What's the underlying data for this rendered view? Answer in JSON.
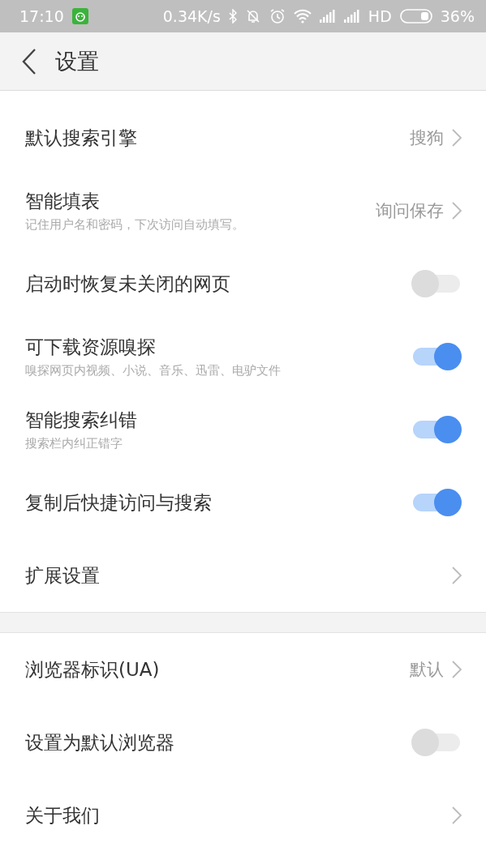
{
  "status_bar": {
    "time": "17:10",
    "speed": "0.34K/s",
    "network": "HD",
    "battery": "36%"
  },
  "header": {
    "title": "设置"
  },
  "sections": [
    {
      "items": [
        {
          "kind": "link",
          "label": "默认搜索引擎",
          "value": "搜狗"
        },
        {
          "kind": "link",
          "label": "智能填表",
          "subtitle": "记住用户名和密码，下次访问自动填写。",
          "value": "询问保存"
        },
        {
          "kind": "toggle",
          "label": "启动时恢复未关闭的网页",
          "on": false
        },
        {
          "kind": "toggle",
          "label": "可下载资源嗅探",
          "subtitle": "嗅探网页内视频、小说、音乐、迅雷、电驴文件",
          "on": true
        },
        {
          "kind": "toggle",
          "label": "智能搜索纠错",
          "subtitle": "搜索栏内纠正错字",
          "on": true
        },
        {
          "kind": "toggle",
          "label": "复制后快捷访问与搜索",
          "on": true
        },
        {
          "kind": "link",
          "label": "扩展设置"
        }
      ]
    },
    {
      "items": [
        {
          "kind": "link",
          "label": "浏览器标识(UA)",
          "value": "默认"
        },
        {
          "kind": "toggle",
          "label": "设置为默认浏览器",
          "on": false
        },
        {
          "kind": "link",
          "label": "关于我们"
        }
      ]
    }
  ]
}
